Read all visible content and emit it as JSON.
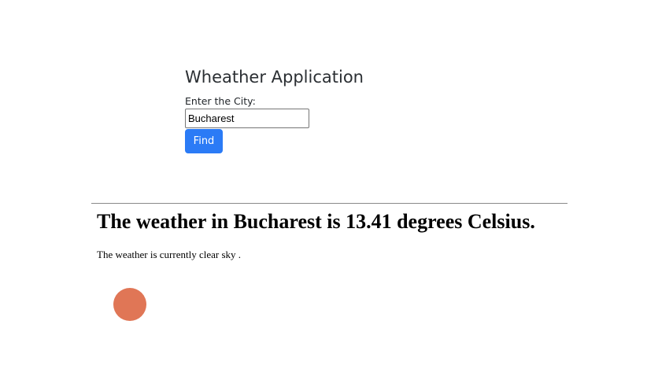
{
  "app": {
    "title": "Wheather Application"
  },
  "form": {
    "city_label": "Enter the City:",
    "city_value": "Bucharest",
    "find_label": "Find"
  },
  "result": {
    "heading": "The weather in Bucharest is 13.41 degrees Celsius.",
    "description": "The weather is currently clear sky ."
  },
  "colors": {
    "button_bg": "#2b7bf6",
    "cursor_dot": "#e07656"
  }
}
